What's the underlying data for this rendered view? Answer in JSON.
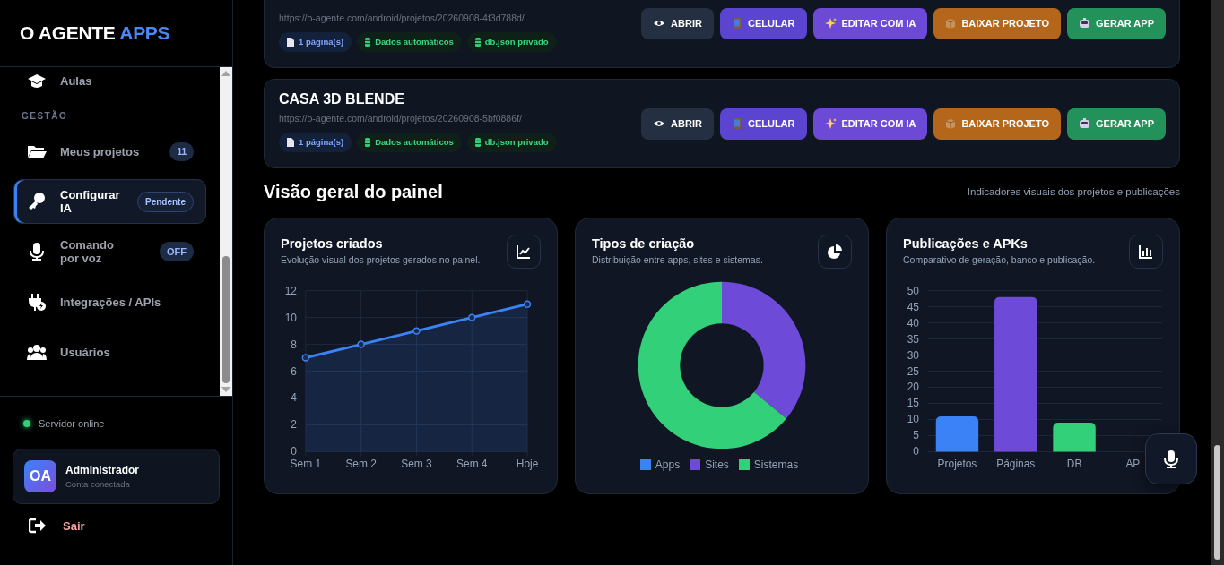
{
  "sidebar": {
    "logo": {
      "text": "O AGENTE",
      "accent": "APPS"
    },
    "nav": [
      {
        "kind": "item",
        "label": "Aulas",
        "selected": false
      },
      {
        "kind": "section",
        "label": "GESTÃO"
      },
      {
        "kind": "item",
        "label": "Meus projetos",
        "selected": false,
        "badge": {
          "kind": "count",
          "text": "11"
        }
      },
      {
        "kind": "item",
        "label": "Configurar IA",
        "selected": true,
        "badge": {
          "kind": "status",
          "text": "Pendente"
        }
      },
      {
        "kind": "item",
        "label": "Comando por voz",
        "selected": false,
        "badge": {
          "kind": "toggle",
          "text": "OFF"
        }
      },
      {
        "kind": "item",
        "label": "Integrações / APIs",
        "selected": false
      },
      {
        "kind": "item",
        "label": "Usuários",
        "selected": false
      }
    ],
    "server": {
      "text": "Servidor online",
      "online": true
    },
    "user": {
      "avatar": "OA",
      "name": "Administrador",
      "subtitle": "Conta conectada"
    },
    "logout": "Sair"
  },
  "projects": [
    {
      "url": "https://o-agente.com/android/projetos/20260908-4f3d788d/",
      "badges": [
        {
          "kind": "pages",
          "text": "1 página(s)"
        },
        {
          "kind": "data",
          "text": "Dados automáticos"
        },
        {
          "kind": "data",
          "text": "db.json privado"
        }
      ],
      "actions": [
        {
          "kind": "open",
          "label": "ABRIR"
        },
        {
          "kind": "phone",
          "label": "CELULAR"
        },
        {
          "kind": "ai",
          "label": "EDITAR COM IA"
        },
        {
          "kind": "download",
          "label": "BAIXAR PROJETO"
        },
        {
          "kind": "build",
          "label": "GERAR APP"
        }
      ]
    },
    {
      "title": "CASA 3D BLENDE",
      "url": "https://o-agente.com/android/projetos/20260908-5bf0886f/",
      "badges": [
        {
          "kind": "pages",
          "text": "1 página(s)"
        },
        {
          "kind": "data",
          "text": "Dados automáticos"
        },
        {
          "kind": "data",
          "text": "db.json privado"
        }
      ],
      "actions": [
        {
          "kind": "open",
          "label": "ABRIR"
        },
        {
          "kind": "phone",
          "label": "CELULAR"
        },
        {
          "kind": "ai",
          "label": "EDITAR COM IA"
        },
        {
          "kind": "download",
          "label": "BAIXAR PROJETO"
        },
        {
          "kind": "build",
          "label": "GERAR APP"
        }
      ]
    }
  ],
  "overview": {
    "title": "Visão geral do painel",
    "subtitle": "Indicadores visuais dos projetos e publicações",
    "cards": [
      {
        "kind": "line",
        "title": "Projetos criados",
        "subtitle": "Evolução visual dos projetos gerados no painel.",
        "chart_data": {
          "type": "area",
          "categories": [
            "Sem 1",
            "Sem 2",
            "Sem 3",
            "Sem 4",
            "Hoje"
          ],
          "series": [
            {
              "color": "#3b82f6",
              "marker": "o",
              "values": [
                7,
                8,
                9,
                10,
                11
              ]
            }
          ],
          "ylim": [
            0,
            12
          ],
          "yticks": [
            0,
            2,
            4,
            6,
            8,
            10,
            12
          ],
          "grid": true
        }
      },
      {
        "kind": "donut",
        "title": "Tipos de criação",
        "subtitle": "Distribuição entre apps, sites e sistemas.",
        "chart_data": {
          "type": "donut",
          "categories": [
            "Apps",
            "Sites",
            "Sistemas"
          ],
          "values": [
            0,
            36,
            64
          ],
          "legend": "bottom"
        },
        "slices": [
          {
            "color": "#3b82f6"
          },
          {
            "color": "#6d4ad8"
          },
          {
            "color": "#33d07a"
          }
        ]
      },
      {
        "kind": "bar",
        "title": "Publicações e APKs",
        "subtitle": "Comparativo de geração, banco e publicação.",
        "chart_data": {
          "type": "bar",
          "categories": [
            "Projetos",
            "Páginas",
            "DB",
            "AP"
          ],
          "series": [
            {
              "values": [
                11,
                48,
                9,
                0
              ]
            }
          ],
          "ylim": [
            0,
            50
          ],
          "yticks": [
            0,
            5,
            10,
            15,
            20,
            25,
            30,
            35,
            40,
            45,
            50
          ],
          "grid": true
        },
        "bars": [
          {
            "color": "#3b82f6"
          },
          {
            "color": "#6d4ad8"
          },
          {
            "color": "#33d07a"
          }
        ]
      }
    ]
  }
}
